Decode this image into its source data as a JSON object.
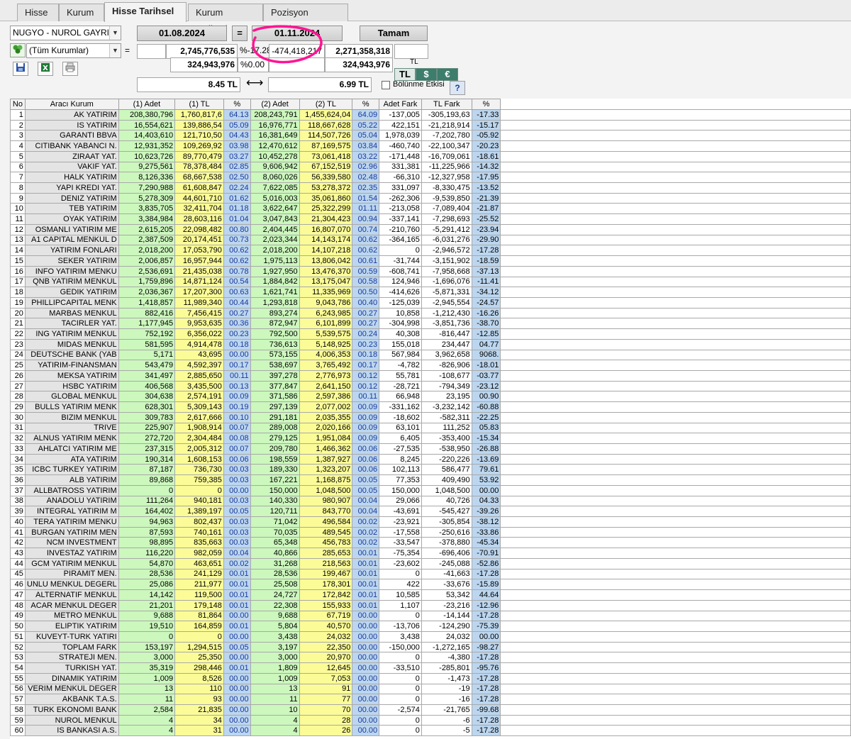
{
  "tabs": [
    {
      "label": "Hisse",
      "active": false
    },
    {
      "label": "Kurum",
      "active": false
    },
    {
      "label": "Hisse Tarihsel",
      "active": true
    },
    {
      "label": "Kurum Tarihsel",
      "active": false
    },
    {
      "label": "Pozisyon Farkları",
      "active": false
    }
  ],
  "filters": {
    "stock": "NUGYO - NUROL GAYRI ME",
    "broker": "(Tüm Kurumlar)",
    "date1": "01.08.2024",
    "equals": "=",
    "date2": "01.11.2024",
    "ok_label": "Tamam",
    "eq_small": "="
  },
  "totals": {
    "val1": "2,745,776,535",
    "pct": "%-17.28",
    "diff": "-474,418,217",
    "val2": "2,271,358,318",
    "qty1": "324,943,976",
    "pct0": "%0.00",
    "qty2": "324,943,976",
    "tl_label": "TL",
    "price1": "8.45 TL",
    "arrow": "⟷",
    "price2": "6.99 TL",
    "bolunme": "Bölünme Etkisi",
    "help": "?"
  },
  "currency": {
    "tl": "TL",
    "usd": "$",
    "eur": "€"
  },
  "colors": {
    "annotation": "#ff1493",
    "green_col": "#ccf7bd",
    "yellow_col": "#fbfb98",
    "blue_col": "#bcd6ef"
  },
  "icons": [
    "add-broker-icon",
    "save-icon",
    "excel-icon",
    "print-icon",
    "help-icon"
  ],
  "table": {
    "headers": [
      "No",
      "Aracı Kurum",
      "(1) Adet",
      "(1) TL",
      "%",
      "(2) Adet",
      "(2) TL",
      "%",
      "Adet Fark",
      "TL Fark",
      "%"
    ],
    "rows": [
      [
        "1",
        "AK YATIRIM",
        "208,380,796",
        "1,760,817,6",
        "64.13",
        "208,243,791",
        "1,455,624,04",
        "64.09",
        "-137,005",
        "-305,193,63",
        "-17.33"
      ],
      [
        "2",
        "IS YATIRIM",
        "16,554,621",
        "139,886,54",
        "05.09",
        "16,976,771",
        "118,667,628",
        "05.22",
        "422,151",
        "-21,218,914",
        "-15.17"
      ],
      [
        "3",
        "GARANTI BBVA",
        "14,403,610",
        "121,710,50",
        "04.43",
        "16,381,649",
        "114,507,726",
        "05.04",
        "1,978,039",
        "-7,202,780",
        "-05.92"
      ],
      [
        "4",
        "CITIBANK YABANCI N.",
        "12,931,352",
        "109,269,92",
        "03.98",
        "12,470,612",
        "87,169,575",
        "03.84",
        "-460,740",
        "-22,100,347",
        "-20.23"
      ],
      [
        "5",
        "ZIRAAT YAT.",
        "10,623,726",
        "89,770,479",
        "03.27",
        "10,452,278",
        "73,061,418",
        "03.22",
        "-171,448",
        "-16,709,061",
        "-18.61"
      ],
      [
        "6",
        "VAKIF YAT.",
        "9,275,561",
        "78,378,484",
        "02.85",
        "9,606,942",
        "67,152,519",
        "02.96",
        "331,381",
        "-11,225,966",
        "-14.32"
      ],
      [
        "7",
        "HALK YATIRIM",
        "8,126,336",
        "68,667,538",
        "02.50",
        "8,060,026",
        "56,339,580",
        "02.48",
        "-66,310",
        "-12,327,958",
        "-17.95"
      ],
      [
        "8",
        "YAPI KREDI YAT.",
        "7,290,988",
        "61,608,847",
        "02.24",
        "7,622,085",
        "53,278,372",
        "02.35",
        "331,097",
        "-8,330,475",
        "-13.52"
      ],
      [
        "9",
        "DENIZ YATIRIM",
        "5,278,309",
        "44,601,710",
        "01.62",
        "5,016,003",
        "35,061,860",
        "01.54",
        "-262,306",
        "-9,539,850",
        "-21.39"
      ],
      [
        "10",
        "TEB YATIRIM",
        "3,835,705",
        "32,411,704",
        "01.18",
        "3,622,647",
        "25,322,299",
        "01.11",
        "-213,058",
        "-7,089,404",
        "-21.87"
      ],
      [
        "11",
        "OYAK YATIRIM",
        "3,384,984",
        "28,603,116",
        "01.04",
        "3,047,843",
        "21,304,423",
        "00.94",
        "-337,141",
        "-7,298,693",
        "-25.52"
      ],
      [
        "12",
        "OSMANLI YATIRIM ME",
        "2,615,205",
        "22,098,482",
        "00.80",
        "2,404,445",
        "16,807,070",
        "00.74",
        "-210,760",
        "-5,291,412",
        "-23.94"
      ],
      [
        "13",
        "A1 CAPITAL MENKUL D",
        "2,387,509",
        "20,174,451",
        "00.73",
        "2,023,344",
        "14,143,174",
        "00.62",
        "-364,165",
        "-6,031,276",
        "-29.90"
      ],
      [
        "14",
        "YATIRIM FONLARI",
        "2,018,200",
        "17,053,790",
        "00.62",
        "2,018,200",
        "14,107,218",
        "00.62",
        "0",
        "-2,946,572",
        "-17.28"
      ],
      [
        "15",
        "SEKER YATIRIM",
        "2,006,857",
        "16,957,944",
        "00.62",
        "1,975,113",
        "13,806,042",
        "00.61",
        "-31,744",
        "-3,151,902",
        "-18.59"
      ],
      [
        "16",
        "INFO YATIRIM MENKU",
        "2,536,691",
        "21,435,038",
        "00.78",
        "1,927,950",
        "13,476,370",
        "00.59",
        "-608,741",
        "-7,958,668",
        "-37.13"
      ],
      [
        "17",
        "QNB YATIRIM MENKUL",
        "1,759,896",
        "14,871,124",
        "00.54",
        "1,884,842",
        "13,175,047",
        "00.58",
        "124,946",
        "-1,696,076",
        "-11.41"
      ],
      [
        "18",
        "GEDIK YATIRIM",
        "2,036,367",
        "17,207,300",
        "00.63",
        "1,621,741",
        "11,335,969",
        "00.50",
        "-414,626",
        "-5,871,331",
        "-34.12"
      ],
      [
        "19",
        "PHILLIPCAPITAL MENK",
        "1,418,857",
        "11,989,340",
        "00.44",
        "1,293,818",
        "9,043,786",
        "00.40",
        "-125,039",
        "-2,945,554",
        "-24.57"
      ],
      [
        "20",
        "MARBAS MENKUL",
        "882,416",
        "7,456,415",
        "00.27",
        "893,274",
        "6,243,985",
        "00.27",
        "10,858",
        "-1,212,430",
        "-16.26"
      ],
      [
        "21",
        "TACIRLER YAT.",
        "1,177,945",
        "9,953,635",
        "00.36",
        "872,947",
        "6,101,899",
        "00.27",
        "-304,998",
        "-3,851,736",
        "-38.70"
      ],
      [
        "22",
        "ING YATIRIM MENKUL",
        "752,192",
        "6,356,022",
        "00.23",
        "792,500",
        "5,539,575",
        "00.24",
        "40,308",
        "-816,447",
        "-12.85"
      ],
      [
        "23",
        "MIDAS MENKUL",
        "581,595",
        "4,914,478",
        "00.18",
        "736,613",
        "5,148,925",
        "00.23",
        "155,018",
        "234,447",
        "04.77"
      ],
      [
        "24",
        "DEUTSCHE BANK (YAB",
        "5,171",
        "43,695",
        "00.00",
        "573,155",
        "4,006,353",
        "00.18",
        "567,984",
        "3,962,658",
        "9068."
      ],
      [
        "25",
        "YATIRIM-FINANSMAN",
        "543,479",
        "4,592,397",
        "00.17",
        "538,697",
        "3,765,492",
        "00.17",
        "-4,782",
        "-826,906",
        "-18.01"
      ],
      [
        "26",
        "MEKSA YATIRIM",
        "341,497",
        "2,885,650",
        "00.11",
        "397,278",
        "2,776,973",
        "00.12",
        "55,781",
        "-108,677",
        "-03.77"
      ],
      [
        "27",
        "HSBC YATIRIM",
        "406,568",
        "3,435,500",
        "00.13",
        "377,847",
        "2,641,150",
        "00.12",
        "-28,721",
        "-794,349",
        "-23.12"
      ],
      [
        "28",
        "GLOBAL MENKUL",
        "304,638",
        "2,574,191",
        "00.09",
        "371,586",
        "2,597,386",
        "00.11",
        "66,948",
        "23,195",
        "00.90"
      ],
      [
        "29",
        "BULLS YATIRIM MENK",
        "628,301",
        "5,309,143",
        "00.19",
        "297,139",
        "2,077,002",
        "00.09",
        "-331,162",
        "-3,232,142",
        "-60.88"
      ],
      [
        "30",
        "BIZIM MENKUL",
        "309,783",
        "2,617,666",
        "00.10",
        "291,181",
        "2,035,355",
        "00.09",
        "-18,602",
        "-582,311",
        "-22.25"
      ],
      [
        "31",
        "TRIVE",
        "225,907",
        "1,908,914",
        "00.07",
        "289,008",
        "2,020,166",
        "00.09",
        "63,101",
        "111,252",
        "05.83"
      ],
      [
        "32",
        "ALNUS YATIRIM MENK",
        "272,720",
        "2,304,484",
        "00.08",
        "279,125",
        "1,951,084",
        "00.09",
        "6,405",
        "-353,400",
        "-15.34"
      ],
      [
        "33",
        "AHLATCI YATIRIM ME",
        "237,315",
        "2,005,312",
        "00.07",
        "209,780",
        "1,466,362",
        "00.06",
        "-27,535",
        "-538,950",
        "-26.88"
      ],
      [
        "34",
        "ATA YATIRIM",
        "190,314",
        "1,608,153",
        "00.06",
        "198,559",
        "1,387,927",
        "00.06",
        "8,245",
        "-220,226",
        "-13.69"
      ],
      [
        "35",
        "ICBC TURKEY YATIRIM",
        "87,187",
        "736,730",
        "00.03",
        "189,330",
        "1,323,207",
        "00.06",
        "102,113",
        "586,477",
        "79.61"
      ],
      [
        "36",
        "ALB YATIRIM",
        "89,868",
        "759,385",
        "00.03",
        "167,221",
        "1,168,875",
        "00.05",
        "77,353",
        "409,490",
        "53.92"
      ],
      [
        "37",
        "ALLBATROSS YATIRIM",
        "0",
        "0",
        "00.00",
        "150,000",
        "1,048,500",
        "00.05",
        "150,000",
        "1,048,500",
        "00.00"
      ],
      [
        "38",
        "ANADOLU YATIRIM",
        "111,264",
        "940,181",
        "00.03",
        "140,330",
        "980,907",
        "00.04",
        "29,066",
        "40,726",
        "04.33"
      ],
      [
        "39",
        "INTEGRAL YATIRIM M",
        "164,402",
        "1,389,197",
        "00.05",
        "120,711",
        "843,770",
        "00.04",
        "-43,691",
        "-545,427",
        "-39.26"
      ],
      [
        "40",
        "TERA YATIRIM MENKU",
        "94,963",
        "802,437",
        "00.03",
        "71,042",
        "496,584",
        "00.02",
        "-23,921",
        "-305,854",
        "-38.12"
      ],
      [
        "41",
        "BURGAN YATIRIM MEN",
        "87,593",
        "740,161",
        "00.03",
        "70,035",
        "489,545",
        "00.02",
        "-17,558",
        "-250,616",
        "-33.86"
      ],
      [
        "42",
        "NCM INVESTMENT",
        "98,895",
        "835,663",
        "00.03",
        "65,348",
        "456,783",
        "00.02",
        "-33,547",
        "-378,880",
        "-45.34"
      ],
      [
        "43",
        "INVESTAZ YATIRIM",
        "116,220",
        "982,059",
        "00.04",
        "40,866",
        "285,653",
        "00.01",
        "-75,354",
        "-696,406",
        "-70.91"
      ],
      [
        "44",
        "GCM YATIRIM MENKUL",
        "54,870",
        "463,651",
        "00.02",
        "31,268",
        "218,563",
        "00.01",
        "-23,602",
        "-245,088",
        "-52.86"
      ],
      [
        "45",
        "PIRAMIT MEN.",
        "28,536",
        "241,129",
        "00.01",
        "28,536",
        "199,467",
        "00.01",
        "0",
        "-41,663",
        "-17.28"
      ],
      [
        "46",
        "UNLU MENKUL DEGERL",
        "25,086",
        "211,977",
        "00.01",
        "25,508",
        "178,301",
        "00.01",
        "422",
        "-33,676",
        "-15.89"
      ],
      [
        "47",
        "ALTERNATIF MENKUL",
        "14,142",
        "119,500",
        "00.01",
        "24,727",
        "172,842",
        "00.01",
        "10,585",
        "53,342",
        "44.64"
      ],
      [
        "48",
        "ACAR MENKUL DEGER",
        "21,201",
        "179,148",
        "00.01",
        "22,308",
        "155,933",
        "00.01",
        "1,107",
        "-23,216",
        "-12.96"
      ],
      [
        "49",
        "METRO MENKUL",
        "9,688",
        "81,864",
        "00.00",
        "9,688",
        "67,719",
        "00.00",
        "0",
        "-14,144",
        "-17.28"
      ],
      [
        "50",
        "ELIPTIK YATIRIM",
        "19,510",
        "164,859",
        "00.01",
        "5,804",
        "40,570",
        "00.00",
        "-13,706",
        "-124,290",
        "-75.39"
      ],
      [
        "51",
        "KUVEYT-TURK YATIRI",
        "0",
        "0",
        "00.00",
        "3,438",
        "24,032",
        "00.00",
        "3,438",
        "24,032",
        "00.00"
      ],
      [
        "52",
        "TOPLAM FARK",
        "153,197",
        "1,294,515",
        "00.05",
        "3,197",
        "22,350",
        "00.00",
        "-150,000",
        "-1,272,165",
        "-98.27"
      ],
      [
        "53",
        "STRATEJI MEN.",
        "3,000",
        "25,350",
        "00.00",
        "3,000",
        "20,970",
        "00.00",
        "0",
        "-4,380",
        "-17.28"
      ],
      [
        "54",
        "TURKISH YAT.",
        "35,319",
        "298,446",
        "00.01",
        "1,809",
        "12,645",
        "00.00",
        "-33,510",
        "-285,801",
        "-95.76"
      ],
      [
        "55",
        "DINAMIK YATIRIM",
        "1,009",
        "8,526",
        "00.00",
        "1,009",
        "7,053",
        "00.00",
        "0",
        "-1,473",
        "-17.28"
      ],
      [
        "56",
        "VERIM MENKUL DEGER",
        "13",
        "110",
        "00.00",
        "13",
        "91",
        "00.00",
        "0",
        "-19",
        "-17.28"
      ],
      [
        "57",
        "AKBANK T.A.S.",
        "11",
        "93",
        "00.00",
        "11",
        "77",
        "00.00",
        "0",
        "-16",
        "-17.28"
      ],
      [
        "58",
        "TURK EKONOMI BANK",
        "2,584",
        "21,835",
        "00.00",
        "10",
        "70",
        "00.00",
        "-2,574",
        "-21,765",
        "-99.68"
      ],
      [
        "59",
        "NUROL MENKUL",
        "4",
        "34",
        "00.00",
        "4",
        "28",
        "00.00",
        "0",
        "-6",
        "-17.28"
      ],
      [
        "60",
        "IS BANKASI A.S.",
        "4",
        "31",
        "00.00",
        "4",
        "26",
        "00.00",
        "0",
        "-5",
        "-17.28"
      ]
    ]
  }
}
